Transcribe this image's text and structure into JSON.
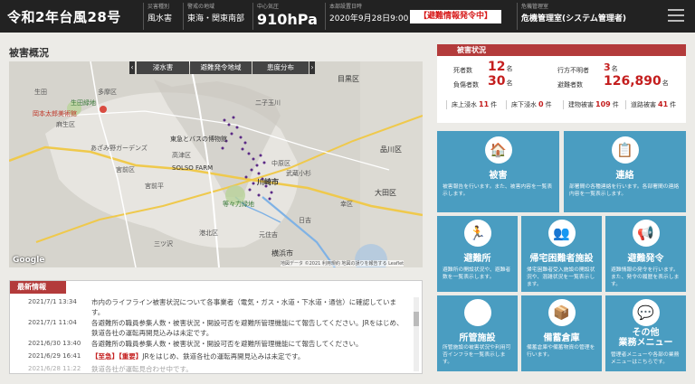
{
  "header": {
    "title": "令和2年台風28号",
    "disaster_type_label": "災害種別",
    "disaster_type": "風水害",
    "region_label": "警戒の地域",
    "region": "東海・関東南部",
    "pressure_label": "中心気圧",
    "pressure": "910hPa",
    "hq_label": "本部設置日時",
    "hq_datetime": "2020年9月28日9:00",
    "alert": "【避難情報発令中】",
    "office_label": "危機管理室",
    "office": "危機管理室(システム管理者)",
    "menu_icon": "hamburger-menu-icon"
  },
  "damage_overview": {
    "title": "被害概況",
    "map_tabs": [
      "浸水害",
      "避難発令地域",
      "患度分布"
    ],
    "map_places": [
      "目黒区",
      "品川区",
      "大田区",
      "麻生区",
      "多摩区",
      "宮前区",
      "高津区",
      "中原区",
      "幸区",
      "川崎市",
      "横浜市",
      "生田緑地",
      "SOLSO FARM",
      "岡本太郎美術館",
      "東急とバスの博物館",
      "等々力緑地",
      "日吉",
      "武蔵小杉",
      "生田",
      "あざみ野ガーデンズ",
      "宮前平",
      "二子玉川",
      "元住吉",
      "港北区",
      "三ツ沢"
    ],
    "map_footer": "Google",
    "map_attribution": "地図データ ©2021  利用規約  地図の誤りを報告する  Leaflet"
  },
  "news": {
    "title": "最新情報",
    "items": [
      {
        "date": "2021/7/1 13:34",
        "text": "市内のライフライン被害状況について各事業者（電気・ガス・水道・下水道・通信）に確認しています。",
        "tag": ""
      },
      {
        "date": "2021/7/1 11:04",
        "text": "各避難所の職員参集人数・被害状況・開設可否を避難所管理機能にて報告してください。JRをはじめ、鉄道各社の運転再開見込みは未定です。",
        "tag": ""
      },
      {
        "date": "2021/6/30 13:40",
        "text": "各避難所の職員参集人数・被害状況・開設可否を避難所管理機能にて報告してください。",
        "tag": ""
      },
      {
        "date": "2021/6/29 16:41",
        "text": "JRをはじめ、鉄道各社の運転再開見込みは未定です。",
        "tag": "【至急】【重要】"
      },
      {
        "date": "2021/6/28 11:22",
        "text": "鉄道各社が運転見合わせ中です。",
        "tag": ""
      }
    ]
  },
  "damage_status": {
    "title": "被害状況",
    "dead_label": "死者数",
    "dead": "12",
    "dead_unit": "名",
    "injured_label": "負傷者数",
    "injured": "30",
    "injured_unit": "名",
    "missing_label": "行方不明者",
    "missing": "3",
    "missing_unit": "名",
    "evacuees_label": "避難者数",
    "evacuees": "126,890",
    "evacuees_unit": "名",
    "above_floor_label": "床上浸水",
    "above_floor": "11",
    "above_floor_unit": "件",
    "below_floor_label": "床下浸水",
    "below_floor": "0",
    "below_floor_unit": "件",
    "building_label": "建物被害",
    "building": "109",
    "building_unit": "件",
    "road_label": "道路被害",
    "road": "41",
    "road_unit": "件"
  },
  "menu_tiles": [
    {
      "title": "被害",
      "text": "被害報告を行います。また、被害内容を一覧表示します。",
      "icon": "house-damage-icon"
    },
    {
      "title": "連絡",
      "text": "部署間の各種連絡を行います。各部署間の連絡内容を一覧表示します。",
      "icon": "notepad-icon"
    },
    {
      "title": "避難所",
      "text": "避難所の開設状況や、避難者数を一覧表示します。",
      "icon": "running-person-icon"
    },
    {
      "title": "帰宅困難者施設",
      "text": "帰宅困難者受入施設の開設状況や、混雑状況を一覧表示します。",
      "icon": "crowd-icon"
    },
    {
      "title": "避難発令",
      "text": "避難情報の発令を行います。また、発令の履歴を表示します。",
      "icon": "megaphone-icon"
    },
    {
      "title": "所管施設",
      "text": "所管施設の被害状況や利用可否インフラを一覧表示します。",
      "icon": "facility-bars-icon"
    },
    {
      "title": "備蓄倉庫",
      "text": "備蓄倉庫や備蓄物資の管理を行います。",
      "icon": "box-icon"
    },
    {
      "title": "その他\n業務メニュー",
      "text": "管理者メニューや各部の業務メニューはこちらです。",
      "icon": "chat-bubble-icon"
    }
  ]
}
